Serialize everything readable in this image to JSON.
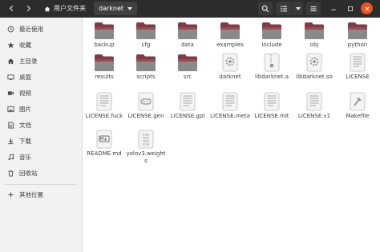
{
  "header": {
    "breadcrumbs": [
      "用户文件夹",
      "darknet"
    ]
  },
  "sidebar": {
    "items": [
      {
        "label": "最近使用",
        "icon": "clock-icon"
      },
      {
        "label": "收藏",
        "icon": "star-icon"
      },
      {
        "label": "主目录",
        "icon": "home-icon"
      },
      {
        "label": "桌面",
        "icon": "desktop-icon"
      },
      {
        "label": "视频",
        "icon": "video-icon"
      },
      {
        "label": "图片",
        "icon": "image-icon"
      },
      {
        "label": "文档",
        "icon": "document-icon"
      },
      {
        "label": "下载",
        "icon": "download-icon"
      },
      {
        "label": "音乐",
        "icon": "music-icon"
      },
      {
        "label": "回收站",
        "icon": "trash-icon"
      }
    ],
    "other_locations": {
      "label": "其他位置",
      "icon": "plus-icon"
    }
  },
  "files": [
    {
      "name": "backup",
      "type": "folder"
    },
    {
      "name": "cfg",
      "type": "folder"
    },
    {
      "name": "data",
      "type": "folder"
    },
    {
      "name": "examples",
      "type": "folder"
    },
    {
      "name": "include",
      "type": "folder"
    },
    {
      "name": "obj",
      "type": "folder"
    },
    {
      "name": "python",
      "type": "folder"
    },
    {
      "name": "results",
      "type": "folder"
    },
    {
      "name": "scripts",
      "type": "folder"
    },
    {
      "name": "src",
      "type": "folder"
    },
    {
      "name": "darknet",
      "type": "executable"
    },
    {
      "name": "libdarknet.a",
      "type": "archive"
    },
    {
      "name": "libdarknet.so",
      "type": "library"
    },
    {
      "name": "LICENSE",
      "type": "text"
    },
    {
      "name": "LICENSE.fuck",
      "type": "text"
    },
    {
      "name": "LICENSE.gen",
      "type": "gamepad"
    },
    {
      "name": "LICENSE.gpl",
      "type": "text"
    },
    {
      "name": "LICENSE.meta",
      "type": "text"
    },
    {
      "name": "LICENSE.mit",
      "type": "text"
    },
    {
      "name": "LICENSE.v1",
      "type": "text"
    },
    {
      "name": "Makefile",
      "type": "makefile"
    },
    {
      "name": "README.md",
      "type": "markdown"
    },
    {
      "name": "yolov3.weights",
      "type": "binary"
    }
  ]
}
